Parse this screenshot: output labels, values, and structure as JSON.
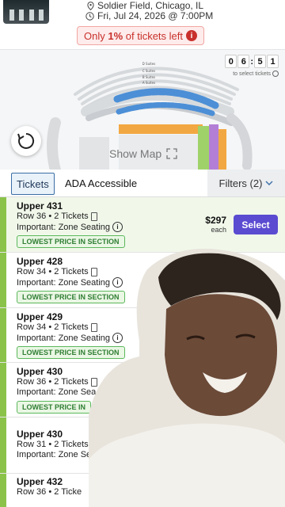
{
  "event": {
    "venue": "Soldier Field, Chicago, IL",
    "date": "Fri, Jul 24, 2026 @ 7:00PM",
    "scarcity": {
      "prefix": "Only ",
      "bold": "1%",
      "suffix": " of tickets left",
      "info": "i"
    }
  },
  "map": {
    "timer": [
      "0",
      "6",
      "5",
      "1"
    ],
    "timer_caption": "to select tickets",
    "tier_labels": [
      "D Suites",
      "C Suites",
      "B Suites",
      "A Suites"
    ],
    "show_map": "Show Map"
  },
  "tabs": {
    "tickets": "Tickets",
    "ada": "ADA Accessible",
    "filters": "Filters (2)"
  },
  "listings": [
    {
      "section": "Upper 431",
      "row": "Row 36 • 2 Tickets",
      "note": "Important: Zone Seating",
      "badge": "LOWEST PRICE IN SECTION",
      "price": "$297",
      "each": "each",
      "button": "Select"
    },
    {
      "section": "Upper 428",
      "row": "Row 34 • 2 Tickets",
      "note": "Important: Zone Seating",
      "badge": "LOWEST PRICE IN SECTION"
    },
    {
      "section": "Upper 429",
      "row": "Row 34 • 2 Tickets",
      "note": "Important: Zone Seating",
      "badge": "LOWEST PRICE IN SECTION"
    },
    {
      "section": "Upper 430",
      "row": "Row 36 • 2 Tickets",
      "note": "Important: Zone Sea",
      "badge": "LOWEST PRICE IN"
    },
    {
      "section": "Upper 430",
      "row": "Row 31 • 2 Tickets",
      "note": "Important: Zone Se"
    },
    {
      "section": "Upper 432",
      "row": "Row 36 • 2 Ticke"
    }
  ],
  "colors": {
    "accent": "#5a4bd1",
    "scarcity": "#c9302c",
    "badge": "#2e7d32",
    "bar": "#8bc34a"
  }
}
